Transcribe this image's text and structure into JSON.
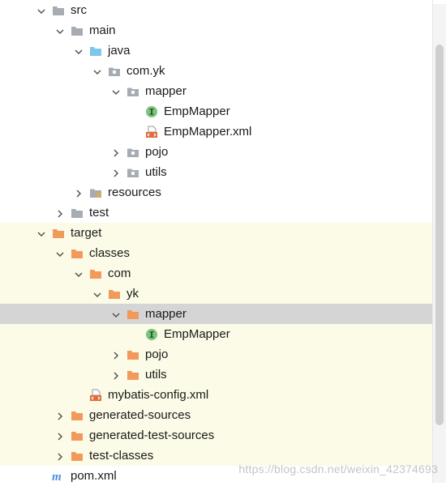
{
  "colors": {
    "folder_gray": "#a6acb2",
    "folder_blue": "#7cc7ea",
    "folder_orange": "#f19a5c",
    "interface_green": "#7bc47f",
    "xml_orange": "#e06c3c",
    "excluded_bg": "#fbfbe7",
    "selected_bg": "#d5d5d5"
  },
  "tree": [
    {
      "label": "src",
      "icon": "folder-gray-icon",
      "arrow": "expanded",
      "depth": 1,
      "excluded": false,
      "selected": false
    },
    {
      "label": "main",
      "icon": "folder-gray-icon",
      "arrow": "expanded",
      "depth": 2,
      "excluded": false,
      "selected": false
    },
    {
      "label": "java",
      "icon": "folder-blue-icon",
      "arrow": "expanded",
      "depth": 3,
      "excluded": false,
      "selected": false
    },
    {
      "label": "com.yk",
      "icon": "package-icon",
      "arrow": "expanded",
      "depth": 4,
      "excluded": false,
      "selected": false
    },
    {
      "label": "mapper",
      "icon": "package-icon",
      "arrow": "expanded",
      "depth": 5,
      "excluded": false,
      "selected": false
    },
    {
      "label": "EmpMapper",
      "icon": "interface-icon",
      "arrow": "none",
      "depth": 6,
      "excluded": false,
      "selected": false
    },
    {
      "label": "EmpMapper.xml",
      "icon": "xml-file-icon",
      "arrow": "none",
      "depth": 6,
      "excluded": false,
      "selected": false
    },
    {
      "label": "pojo",
      "icon": "package-icon",
      "arrow": "collapsed",
      "depth": 5,
      "excluded": false,
      "selected": false
    },
    {
      "label": "utils",
      "icon": "package-icon",
      "arrow": "collapsed",
      "depth": 5,
      "excluded": false,
      "selected": false
    },
    {
      "label": "resources",
      "icon": "resources-folder-icon",
      "arrow": "collapsed",
      "depth": 3,
      "excluded": false,
      "selected": false
    },
    {
      "label": "test",
      "icon": "folder-gray-icon",
      "arrow": "collapsed",
      "depth": 2,
      "excluded": false,
      "selected": false
    },
    {
      "label": "target",
      "icon": "folder-orange-icon",
      "arrow": "expanded",
      "depth": 1,
      "excluded": true,
      "selected": false
    },
    {
      "label": "classes",
      "icon": "folder-orange-icon",
      "arrow": "expanded",
      "depth": 2,
      "excluded": true,
      "selected": false
    },
    {
      "label": "com",
      "icon": "folder-orange-icon",
      "arrow": "expanded",
      "depth": 3,
      "excluded": true,
      "selected": false
    },
    {
      "label": "yk",
      "icon": "folder-orange-icon",
      "arrow": "expanded",
      "depth": 4,
      "excluded": true,
      "selected": false
    },
    {
      "label": "mapper",
      "icon": "folder-orange-icon",
      "arrow": "expanded",
      "depth": 5,
      "excluded": true,
      "selected": true
    },
    {
      "label": "EmpMapper",
      "icon": "interface-icon",
      "arrow": "none",
      "depth": 6,
      "excluded": true,
      "selected": false
    },
    {
      "label": "pojo",
      "icon": "folder-orange-icon",
      "arrow": "collapsed",
      "depth": 5,
      "excluded": true,
      "selected": false
    },
    {
      "label": "utils",
      "icon": "folder-orange-icon",
      "arrow": "collapsed",
      "depth": 5,
      "excluded": true,
      "selected": false
    },
    {
      "label": "mybatis-config.xml",
      "icon": "xml-file-icon",
      "arrow": "none",
      "depth": 3,
      "excluded": true,
      "selected": false
    },
    {
      "label": "generated-sources",
      "icon": "folder-orange-icon",
      "arrow": "collapsed",
      "depth": 2,
      "excluded": true,
      "selected": false
    },
    {
      "label": "generated-test-sources",
      "icon": "folder-orange-icon",
      "arrow": "collapsed",
      "depth": 2,
      "excluded": true,
      "selected": false
    },
    {
      "label": "test-classes",
      "icon": "folder-orange-icon",
      "arrow": "collapsed",
      "depth": 2,
      "excluded": true,
      "selected": false
    },
    {
      "label": "pom.xml",
      "icon": "maven-file-icon",
      "arrow": "none",
      "depth": 1,
      "excluded": false,
      "selected": false
    }
  ],
  "watermark": "https://blog.csdn.net/weixin_42374693"
}
